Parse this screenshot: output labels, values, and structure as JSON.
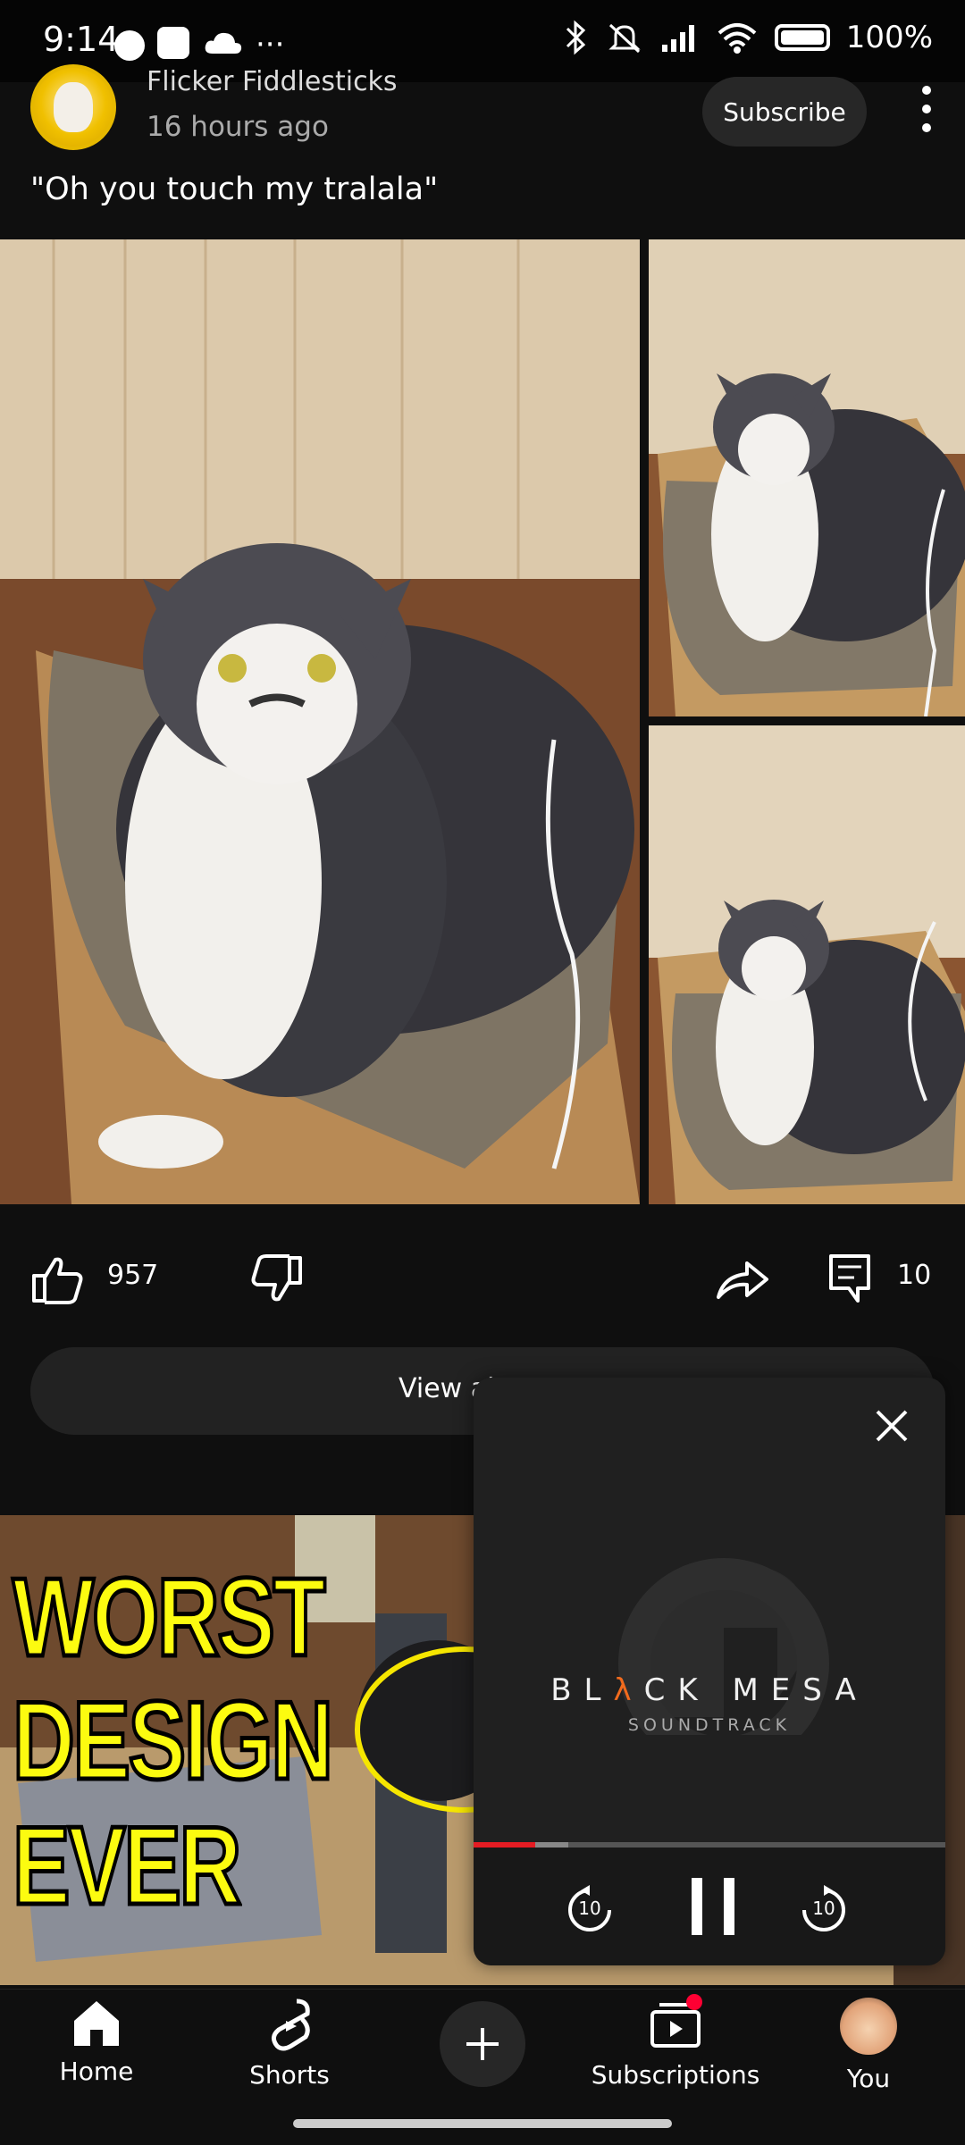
{
  "status_bar": {
    "time": "9:14",
    "battery": "100%"
  },
  "post": {
    "channel_name": "Flicker Fiddlesticks",
    "time_ago": "16 hours ago",
    "subscribe_label": "Subscribe",
    "caption": "\"Oh you touch my tralala\"",
    "like_count": "957",
    "comment_count": "10",
    "view_all_label": "View al"
  },
  "thumbnail": {
    "lines": [
      "WORST",
      "DESIGN",
      "EVER"
    ]
  },
  "miniplayer": {
    "title_pre": "BL",
    "title_lambda": "λ",
    "title_post": "CK MESA",
    "subtitle": "SOUNDTRACK",
    "progress": 0.13,
    "buffered": 0.2,
    "rewind_label": "10",
    "forward_label": "10",
    "accent_color": "#e51c23",
    "lambda_color": "#f26b1d"
  },
  "nav": {
    "home": "Home",
    "shorts": "Shorts",
    "subscriptions": "Subscriptions",
    "you": "You"
  }
}
